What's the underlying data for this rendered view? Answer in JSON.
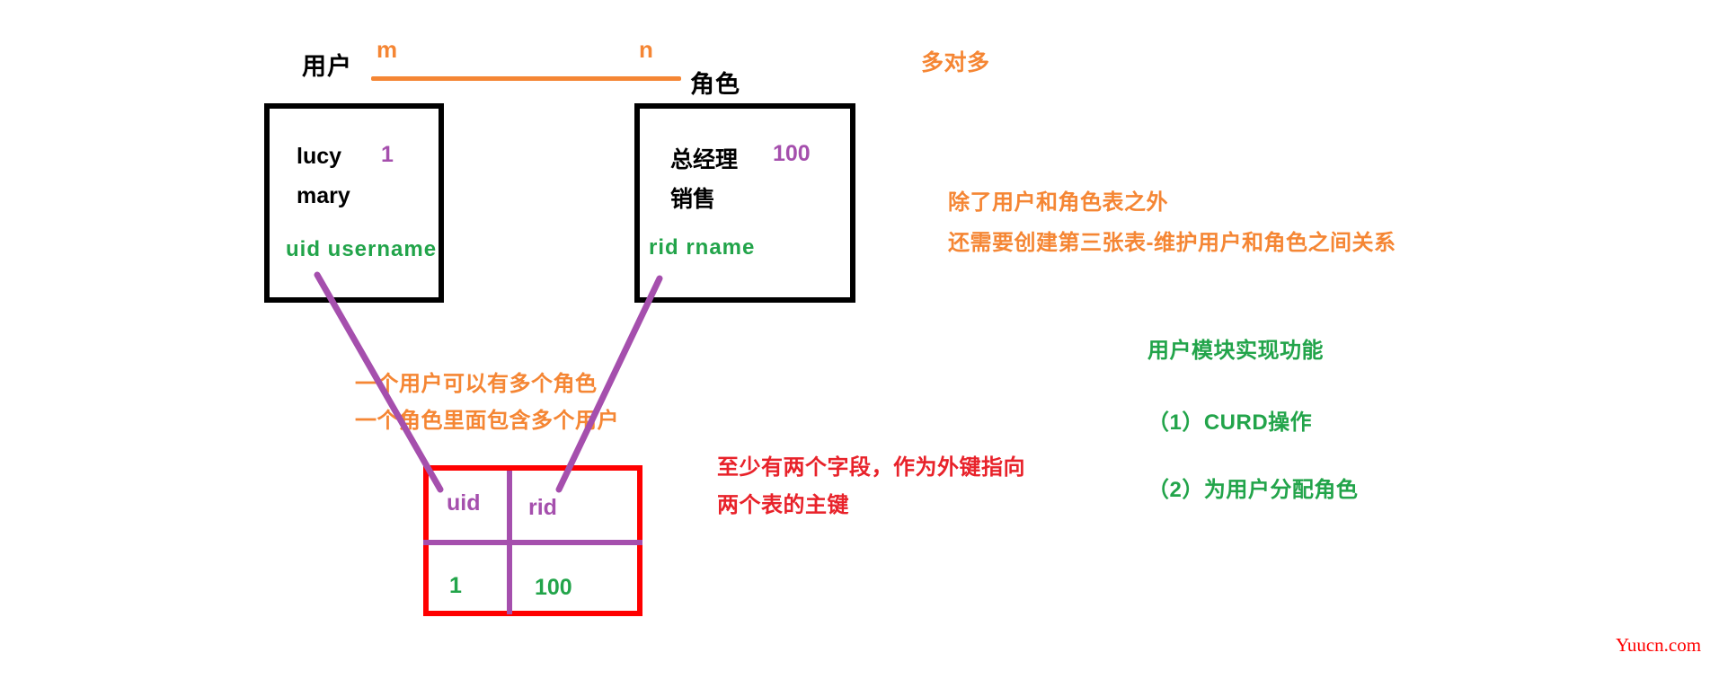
{
  "relationship": {
    "left_entity": "用户",
    "right_entity": "角色",
    "left_cardinality": "m",
    "right_cardinality": "n",
    "type_note": "多对多",
    "line_color": "#F58634"
  },
  "user_table": {
    "rows": [
      {
        "name": "lucy",
        "id": "1"
      },
      {
        "name": "mary",
        "id": ""
      }
    ],
    "fields": "uid  username",
    "border_color": "#000000",
    "field_color": "#22A44A",
    "id_color": "#A54FAD"
  },
  "role_table": {
    "rows": [
      {
        "name": "总经理",
        "id": "100"
      },
      {
        "name": "销售",
        "id": ""
      }
    ],
    "fields": "rid   rname",
    "border_color": "#000000",
    "field_color": "#22A44A",
    "id_color": "#A54FAD"
  },
  "join_table": {
    "headers": [
      "uid",
      "rid"
    ],
    "values": [
      "1",
      "100"
    ],
    "border_color": "#FF0000",
    "divider_color": "#A54FAD",
    "header_color": "#A54FAD",
    "value_color": "#22A44A"
  },
  "notes": {
    "orange_right": [
      "除了用户和角色表之外",
      "还需要创建第三张表-维护用户和角色之间关系"
    ],
    "orange_middle": [
      "一个用户可以有多个角色",
      "一个角色里面包含多个用户"
    ],
    "red_middle": [
      "至少有两个字段，作为外键指向",
      "两个表的主键"
    ],
    "green_heading": "用户模块实现功能",
    "green_items": [
      "（1）CURD操作",
      "（2）为用户分配角色"
    ]
  },
  "watermark": {
    "text": "Yuucn.com",
    "color": "#FF0000"
  },
  "colors": {
    "orange": "#F58634",
    "green": "#22A44A",
    "purple": "#A54FAD",
    "red": "#E8222A",
    "bright_red": "#FF0000",
    "black": "#000000"
  }
}
